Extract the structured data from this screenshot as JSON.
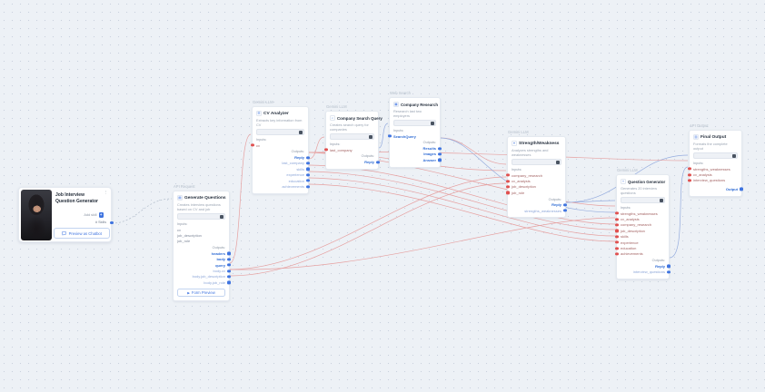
{
  "app": {
    "background": "#edf1f6"
  },
  "colors": {
    "accent_blue": "#2e6bd4",
    "port_blue": "#3f74e0",
    "port_red": "#e0504f",
    "edge_red": "#e6a0a0",
    "edge_blue": "#95acde",
    "secondary_blue": "#8ca6d8"
  },
  "labels": {
    "inputs": "Inputs:",
    "outputs": "Outputs:"
  },
  "chatbot_card": {
    "title_line1": "Job Interview",
    "title_line2": "Question Generator",
    "menu_icon": "⋮",
    "add_skill_label": "Add skill",
    "add_skill_button": "+",
    "skills_label": "# Skills",
    "preview_button": "Preview as Chatbot"
  },
  "nodes": [
    {
      "category": "API Request",
      "title": "Generate Questions",
      "description": "Creates interview questions based on CV and job",
      "inputs": [
        {
          "label": "cv"
        },
        {
          "label": "job_description"
        },
        {
          "label": "job_role"
        }
      ],
      "outputs": [
        {
          "label": "headers"
        },
        {
          "label": "body"
        },
        {
          "label": "query"
        },
        {
          "label": "body.cv"
        },
        {
          "label": "body.job_description"
        },
        {
          "label": "body.job_role"
        }
      ],
      "footer_button": "Form Preview"
    },
    {
      "category": "Gemini LLM",
      "title": "CV Analyzer",
      "description": "Extracts key information from CV",
      "inputs": [
        {
          "label": "cv"
        }
      ],
      "outputs": [
        {
          "label": "Reply"
        },
        {
          "label": "last_company"
        },
        {
          "label": "skills"
        },
        {
          "label": "experience"
        },
        {
          "label": "education"
        },
        {
          "label": "achievements"
        }
      ]
    },
    {
      "category": "Gemini LLM",
      "title": "Company Search Query",
      "description": "Creates search query for companies",
      "inputs": [
        {
          "label": "last_company"
        }
      ],
      "outputs": [
        {
          "label": "Reply"
        }
      ]
    },
    {
      "category": "Web Search",
      "title": "Company Research",
      "description": "Research last two employers",
      "inputs": [
        {
          "label": "SearchQuery"
        }
      ],
      "outputs": [
        {
          "label": "Results"
        },
        {
          "label": "Images"
        },
        {
          "label": "Answer"
        }
      ]
    },
    {
      "category": "Gemini LLM",
      "title": "Strength/Weakness",
      "description": "Analyzes strengths and weaknesses",
      "inputs": [
        {
          "label": "company_research"
        },
        {
          "label": "cv_analysis"
        },
        {
          "label": "job_description"
        },
        {
          "label": "job_role"
        }
      ],
      "outputs": [
        {
          "label": "Reply"
        },
        {
          "label": "strengths_weaknesses"
        }
      ]
    },
    {
      "category": "Gemini LLM",
      "title": "Question Generator",
      "description": "Generates 20 interview questions",
      "inputs": [
        {
          "label": "strengths_weaknesses"
        },
        {
          "label": "cv_analysis"
        },
        {
          "label": "company_research"
        },
        {
          "label": "job_description"
        },
        {
          "label": "skills"
        },
        {
          "label": "experience"
        },
        {
          "label": "education"
        },
        {
          "label": "achievements"
        }
      ],
      "outputs": [
        {
          "label": "Reply"
        },
        {
          "label": "interview_questions"
        }
      ]
    },
    {
      "category": "API Output",
      "title": "Final Output",
      "description": "Formats the complete output",
      "inputs": [
        {
          "label": "strengths_weaknesses"
        },
        {
          "label": "cv_analysis"
        },
        {
          "label": "interview_questions"
        }
      ],
      "outputs": [
        {
          "label": "Output"
        }
      ]
    }
  ],
  "edges": [
    {
      "from": "chatbot-card.skills",
      "to": "generate-questions",
      "style": "dashed"
    },
    {
      "from": "generate-questions.body.cv",
      "to": "cv-analyzer.cv",
      "color": "red"
    },
    {
      "from": "cv-analyzer.last_company",
      "to": "company-search-query.last_company",
      "color": "red"
    },
    {
      "from": "company-search-query.Reply",
      "to": "company-research.SearchQuery",
      "color": "blue"
    },
    {
      "from": "company-research.Results",
      "to": "strength-weakness.company_research",
      "color": "red"
    },
    {
      "from": "cv-analyzer.Reply",
      "to": "strength-weakness.cv_analysis",
      "color": "red"
    },
    {
      "from": "generate-questions.body.job_description",
      "to": "strength-weakness.job_description",
      "color": "red"
    },
    {
      "from": "generate-questions.body.job_role",
      "to": "strength-weakness.job_role",
      "color": "red"
    },
    {
      "from": "strength-weakness.strengths_weaknesses",
      "to": "question-generator.strengths_weaknesses",
      "color": "blue"
    },
    {
      "from": "cv-analyzer.Reply",
      "to": "question-generator.cv_analysis",
      "color": "red"
    },
    {
      "from": "company-research.Results",
      "to": "question-generator.company_research",
      "color": "blue"
    },
    {
      "from": "generate-questions.body.job_description",
      "to": "question-generator.job_description",
      "color": "red"
    },
    {
      "from": "cv-analyzer.skills",
      "to": "question-generator.skills",
      "color": "red"
    },
    {
      "from": "cv-analyzer.experience",
      "to": "question-generator.experience",
      "color": "red"
    },
    {
      "from": "cv-analyzer.education",
      "to": "question-generator.education",
      "color": "red"
    },
    {
      "from": "cv-analyzer.achievements",
      "to": "question-generator.achievements",
      "color": "red"
    },
    {
      "from": "strength-weakness.strengths_weaknesses",
      "to": "final-output.strengths_weaknesses",
      "color": "blue"
    },
    {
      "from": "cv-analyzer.Reply",
      "to": "final-output.cv_analysis",
      "color": "red"
    },
    {
      "from": "question-generator.interview_questions",
      "to": "final-output.interview_questions",
      "color": "blue"
    }
  ]
}
